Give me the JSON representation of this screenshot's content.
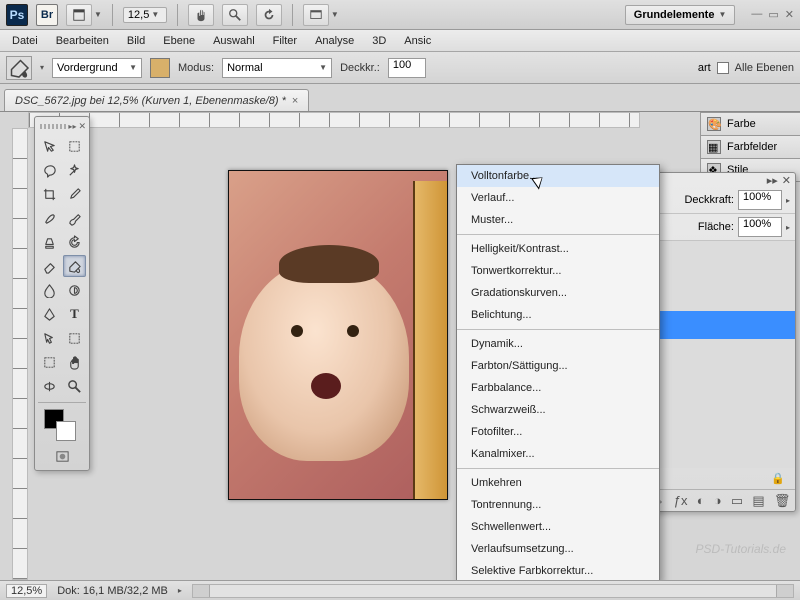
{
  "appbar": {
    "zoom": "12,5",
    "workspace": "Grundelemente"
  },
  "menubar": [
    "Datei",
    "Bearbeiten",
    "Bild",
    "Ebene",
    "Auswahl",
    "Filter",
    "Analyse",
    "3D",
    "Ansic"
  ],
  "optbar": {
    "source_label": "Vordergrund",
    "mode_label": "Modus:",
    "mode_value": "Normal",
    "opacity_label": "Deckkr.:",
    "opacity_value": "100",
    "all_layers": "Alle Ebenen"
  },
  "tab": {
    "title": "DSC_5672.jpg bei 12,5% (Kurven 1, Ebenenmaske/8) *"
  },
  "panel_tabs": [
    "Farbe",
    "Farbfelder",
    "Stile"
  ],
  "layers": {
    "opacity_label": "Deckkraft:",
    "opacity_value": "100%",
    "fill_label": "Fläche:",
    "fill_value": "100%"
  },
  "dropdown": {
    "groups": [
      [
        "Volltonfarbe...",
        "Verlauf...",
        "Muster..."
      ],
      [
        "Helligkeit/Kontrast...",
        "Tonwertkorrektur...",
        "Gradationskurven...",
        "Belichtung..."
      ],
      [
        "Dynamik...",
        "Farbton/Sättigung...",
        "Farbbalance...",
        "Schwarzweiß...",
        "Fotofilter...",
        "Kanalmixer..."
      ],
      [
        "Umkehren",
        "Tontrennung...",
        "Schwellenwert...",
        "Verlaufsumsetzung...",
        "Selektive Farbkorrektur..."
      ]
    ],
    "highlighted": "Volltonfarbe..."
  },
  "statusbar": {
    "zoom": "12,5%",
    "doc": "Dok: 16,1 MB/32,2 MB"
  },
  "watermark": "PSD-Tutorials.de"
}
